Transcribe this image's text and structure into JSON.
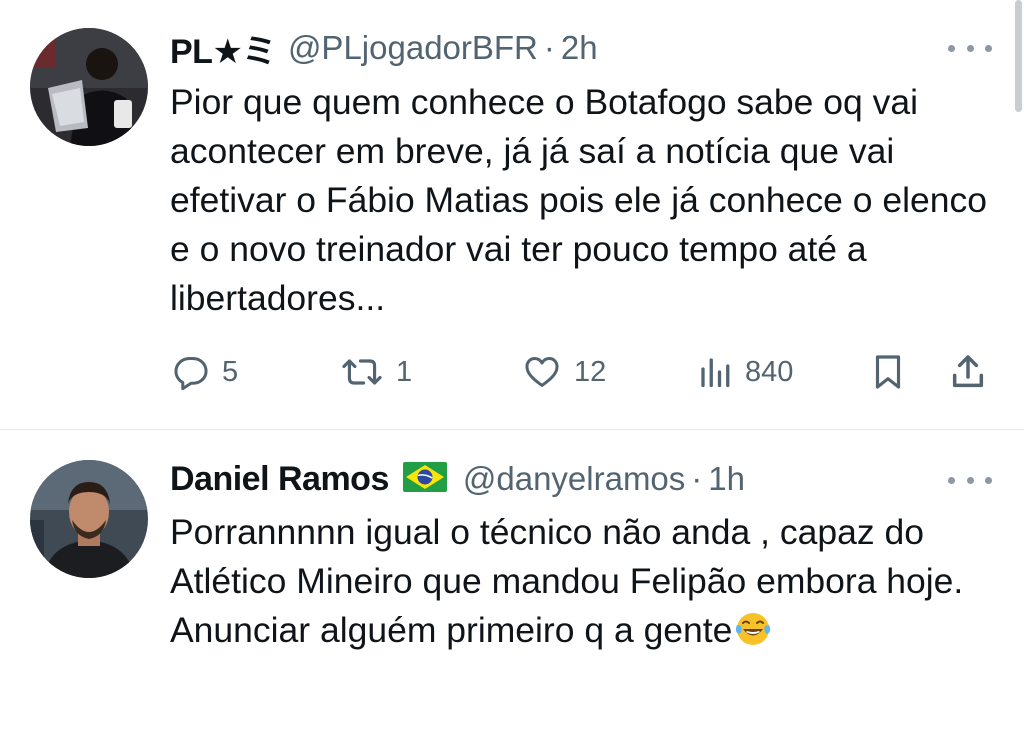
{
  "tweets": [
    {
      "display_name": "PL★ミ",
      "handle": "@PLjogadorBFR",
      "separator": "·",
      "time": "2h",
      "text": "Pior que quem conhece o Botafogo sabe oq vai acontecer em breve, já já saí a notícia que vai efetivar o Fábio Matias pois ele já conhece o elenco e o novo treinador vai ter pouco tempo até a libertadores...",
      "replies": "5",
      "reposts": "1",
      "likes": "12",
      "views": "840"
    },
    {
      "display_name": "Daniel Ramos",
      "handle": "@danyelramos",
      "separator": "·",
      "time": "1h",
      "text": "Porrannnnn igual o técnico não anda , capaz do Atlético Mineiro que mandou Felipão embora hoje.  Anunciar alguém primeiro q a gente",
      "flag_icon": "brazil-flag-icon",
      "emoji_icon": "tears-of-joy-emoji-icon"
    }
  ],
  "colors": {
    "text": "#0f1419",
    "secondary": "#536471",
    "divider": "#e7e9ea",
    "background": "#ffffff"
  }
}
